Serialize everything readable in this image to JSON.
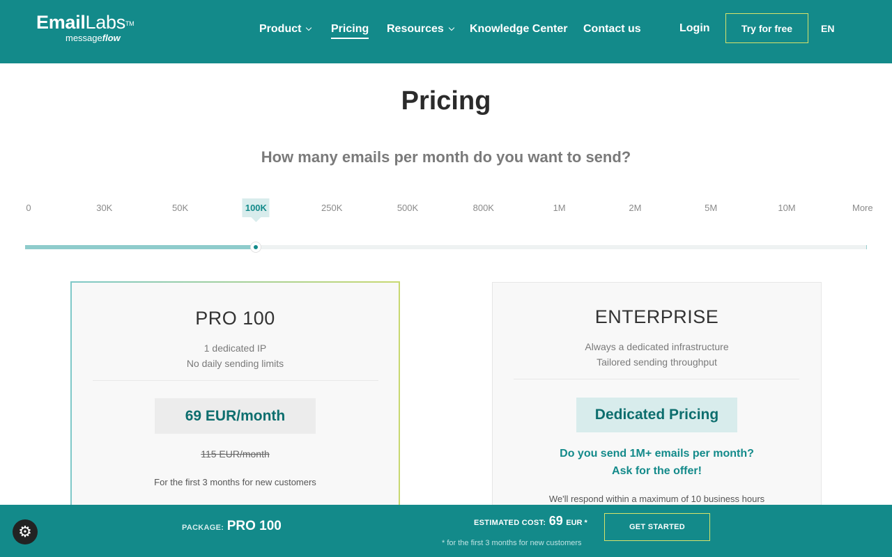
{
  "header": {
    "logo_main_bold": "Email",
    "logo_main_rest": "Labs",
    "logo_tm": "TM",
    "logo_sub_prefix": "message",
    "logo_sub_bold": "flow",
    "nav": [
      {
        "label": "Product",
        "has_dropdown": true
      },
      {
        "label": "Pricing",
        "active": true
      },
      {
        "label": "Resources",
        "has_dropdown": true
      },
      {
        "label": "Knowledge Center"
      },
      {
        "label": "Contact us"
      }
    ],
    "login": "Login",
    "try_free": "Try for free",
    "lang": "EN"
  },
  "main": {
    "title": "Pricing",
    "question": "How many emails per month do you want to send?"
  },
  "slider": {
    "ticks": [
      "0",
      "30K",
      "50K",
      "100K",
      "250K",
      "500K",
      "800K",
      "1M",
      "2M",
      "5M",
      "10M",
      "More"
    ],
    "selected": "100K",
    "selected_index": 3
  },
  "cards": {
    "pro": {
      "name": "PRO 100",
      "desc_1": "1 dedicated IP",
      "desc_2": "No daily sending limits",
      "price": "69 EUR/month",
      "old_price": "115 EUR/month",
      "note": "For the first 3 months for new customers"
    },
    "enterprise": {
      "name": "ENTERPRISE",
      "desc_1": "Always a dedicated infrastructure",
      "desc_2": "Tailored sending throughput",
      "price": "Dedicated Pricing",
      "ask_1": "Do you send 1M+ emails per month?",
      "ask_2": "Ask for the offer!",
      "respond": "We'll respond within a maximum of 10 business hours"
    }
  },
  "bottom_bar": {
    "package_label": "PACKAGE:",
    "package_value": "PRO 100",
    "est_label": "ESTIMATED COST:",
    "est_value": "69",
    "est_unit": "EUR *",
    "est_note": "* for the first 3 months for new customers",
    "cta": "GET STARTED"
  },
  "colors": {
    "brand": "#138a8a",
    "accent_border": "#d8e36a",
    "price_text": "#0d6e6e"
  },
  "icons": {
    "cookie": "gear-icon"
  }
}
